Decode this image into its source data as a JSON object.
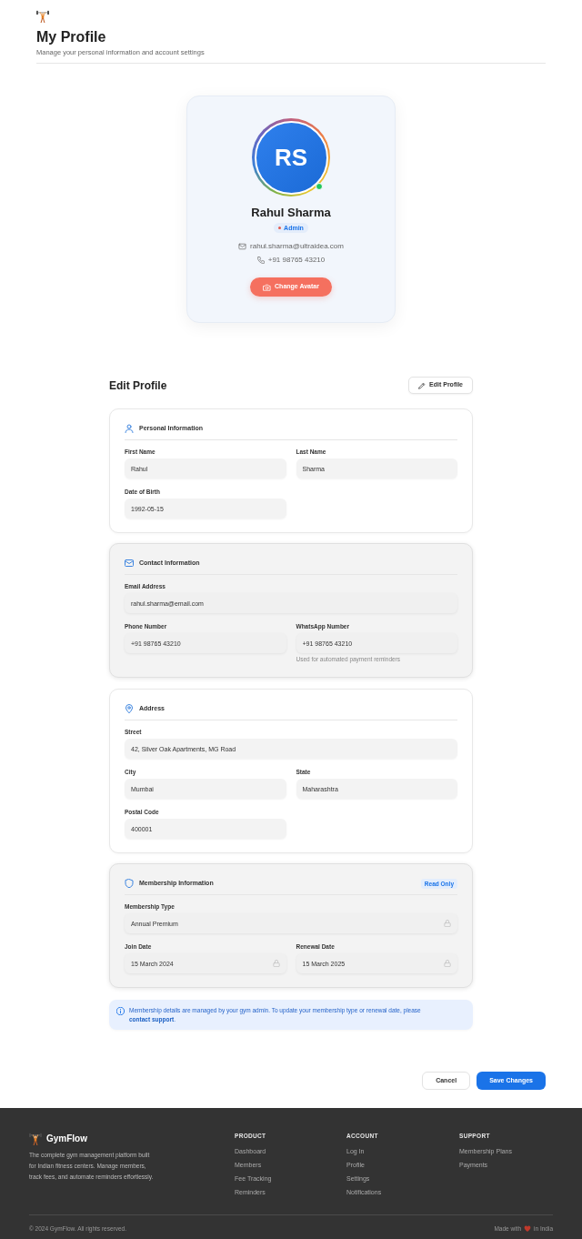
{
  "header": {
    "title": "My Profile",
    "subtitle": "Manage your personal information and account settings"
  },
  "profile_card": {
    "initials": "RS",
    "online": true,
    "name": "Rahul Sharma",
    "role": "Admin",
    "email": "rahul.sharma@ultraidea.com",
    "phone": "+91 98765 43210",
    "change_avatar_button": "Change Avatar"
  },
  "edit_header": {
    "title": "Edit Profile",
    "button": "Edit Profile"
  },
  "sections": [
    {
      "kind": "personal",
      "title": "Personal Information",
      "shaded": false,
      "fields": [
        {
          "label": "First Name",
          "value": "Rahul",
          "wide": false,
          "locked": false
        },
        {
          "label": "Last Name",
          "value": "Sharma",
          "wide": false,
          "locked": false
        },
        {
          "label": "Date of Birth",
          "value": "1992-05-15",
          "wide": false,
          "locked": false
        }
      ]
    },
    {
      "kind": "contact",
      "title": "Contact Information",
      "shaded": true,
      "fields": [
        {
          "label": "Email Address",
          "value": "rahul.sharma@email.com",
          "wide": true,
          "locked": false
        },
        {
          "label": "Phone Number",
          "value": "+91 98765 43210",
          "wide": false,
          "locked": false
        },
        {
          "label": "WhatsApp Number",
          "value": "+91 98765 43210",
          "wide": false,
          "locked": false,
          "hint": "Used for automated payment reminders"
        }
      ]
    },
    {
      "kind": "address",
      "title": "Address",
      "shaded": false,
      "fields": [
        {
          "label": "Street",
          "value": "42, Silver Oak Apartments, MG Road",
          "wide": true,
          "locked": false
        },
        {
          "label": "City",
          "value": "Mumbai",
          "wide": false,
          "locked": false
        },
        {
          "label": "State",
          "value": "Maharashtra",
          "wide": false,
          "locked": false
        },
        {
          "label": "Postal Code",
          "value": "400001",
          "wide": false,
          "locked": false
        }
      ]
    },
    {
      "kind": "membership",
      "title": "Membership Information",
      "shaded": true,
      "badge": "Read Only",
      "fields": [
        {
          "label": "Membership Type",
          "value": "Annual Premium",
          "wide": true,
          "locked": true
        },
        {
          "label": "Join Date",
          "value": "15 March 2024",
          "wide": false,
          "locked": true
        },
        {
          "label": "Renewal Date",
          "value": "15 March 2025",
          "wide": false,
          "locked": true
        }
      ]
    }
  ],
  "notice": {
    "text_before": "Membership details are managed by your gym admin. To update your membership type or renewal date, please ",
    "link": "contact support",
    "text_after": "."
  },
  "actions": {
    "cancel": "Cancel",
    "save": "Save Changes"
  },
  "footer": {
    "brand": "GymFlow",
    "description": "The complete gym management platform built for Indian fitness centers. Manage members, track fees, and automate reminders effortlessly.",
    "columns": [
      {
        "heading": "PRODUCT",
        "links": [
          "Dashboard",
          "Members",
          "Fee Tracking",
          "Reminders"
        ]
      },
      {
        "heading": "ACCOUNT",
        "links": [
          "Log In",
          "Profile",
          "Settings",
          "Notifications"
        ]
      },
      {
        "heading": "SUPPORT",
        "links": [
          "Membership Plans",
          "Payments"
        ]
      }
    ],
    "copyright": "© 2024 GymFlow. All rights reserved.",
    "made_with": "Made with",
    "made_in": "in India"
  }
}
